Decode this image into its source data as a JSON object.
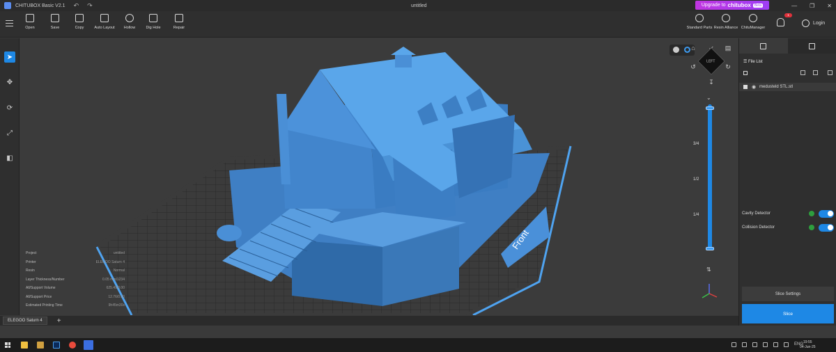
{
  "titlebar": {
    "app": "CHITUBOX Basic V2.1",
    "document": "untitled",
    "upgrade_prefix": "Upgrade to",
    "upgrade_brand": "chitubox",
    "upgrade_badge": "Beta"
  },
  "toolbar": {
    "tools": [
      "Open",
      "Save",
      "Copy",
      "Auto Layout",
      "Hollow",
      "Dig Hole",
      "Repair"
    ],
    "right_tools": [
      "Standard Parts",
      "Resin Alliance",
      "ChituManager"
    ],
    "notification_count": "1",
    "login": "Login"
  },
  "viewport": {
    "build_plate_label": "Front",
    "layer_marks": [
      "3/4",
      "1/2",
      "1/4"
    ],
    "info": [
      {
        "label": "Project",
        "value": "untitled"
      },
      {
        "label": "Printer",
        "value": "ELEGOO Saturn 4"
      },
      {
        "label": "Resin",
        "value": "Normal"
      },
      {
        "label": "Layer Thickness/Number",
        "value": "0.05 mm/1234"
      },
      {
        "label": "All/Support Volume",
        "value": "625.49/0.00"
      },
      {
        "label": "All/Support Price",
        "value": "12.76/0.00"
      },
      {
        "label": "Estimated Printing Time",
        "value": "9h45m30s"
      }
    ],
    "cube_face": "LEFT"
  },
  "right_panel": {
    "file_list_title": "File List",
    "file_name": "medusteld STL.stl",
    "detectors": [
      {
        "label": "Cavity Detector"
      },
      {
        "label": "Collision Detector"
      }
    ],
    "slice_settings": "Slice Settings",
    "slice": "Slice"
  },
  "bottombar": {
    "printer_tab": "ELEGOO Saturn 4"
  },
  "taskbar": {
    "lang": "ENG",
    "time": "19:55",
    "date": "04-Jun-25"
  },
  "colors": {
    "accent": "#1e88e5",
    "model": "#4a90d9",
    "upgrade": "#b23be8"
  }
}
